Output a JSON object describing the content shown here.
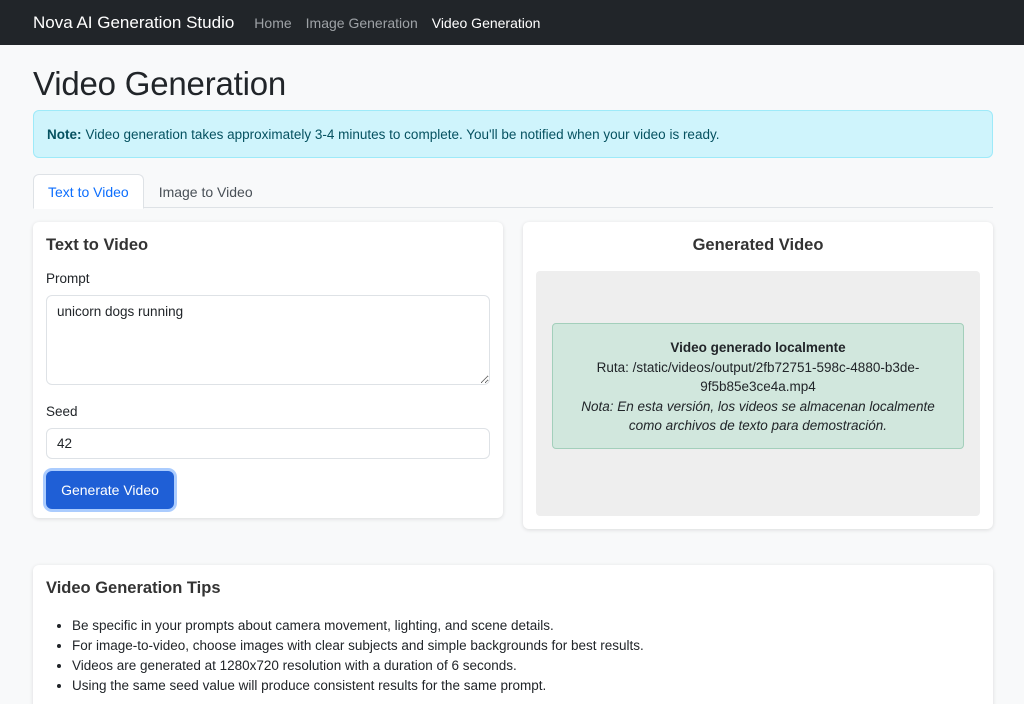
{
  "navbar": {
    "brand": "Nova AI Generation Studio",
    "links": [
      {
        "label": "Home"
      },
      {
        "label": "Image Generation"
      },
      {
        "label": "Video Generation"
      }
    ]
  },
  "page": {
    "title": "Video Generation"
  },
  "alert": {
    "strong": "Note:",
    "text": "Video generation takes approximately 3-4 minutes to complete. You'll be notified when your video is ready."
  },
  "tabs": [
    {
      "label": "Text to Video",
      "active": true
    },
    {
      "label": "Image to Video",
      "active": false
    }
  ],
  "form": {
    "title": "Text to Video",
    "prompt_label": "Prompt",
    "prompt_value": "unicorn dogs running",
    "seed_label": "Seed",
    "seed_value": "42",
    "submit_label": "Generate Video"
  },
  "result": {
    "title": "Generated Video",
    "message_title": "Video generado localmente",
    "path_text": "Ruta: /static/videos/output/2fb72751-598c-4880-b3de-9f5b85e3ce4a.mp4",
    "note_text": "Nota: En esta versión, los videos se almacenan localmente como archivos de texto para demostración."
  },
  "tips": {
    "title": "Video Generation Tips",
    "items": [
      "Be specific in your prompts about camera movement, lighting, and scene details.",
      "For image-to-video, choose images with clear subjects and simple backgrounds for best results.",
      "Videos are generated at 1280x720 resolution with a duration of 6 seconds.",
      "Using the same seed value will produce consistent results for the same prompt."
    ]
  },
  "colors": {
    "navbar_bg": "#212529",
    "primary": "#0d6efd",
    "button_bg": "#1f5fd6",
    "alert_info_bg": "#cff4fc",
    "success_bg": "#d1e7dd"
  }
}
